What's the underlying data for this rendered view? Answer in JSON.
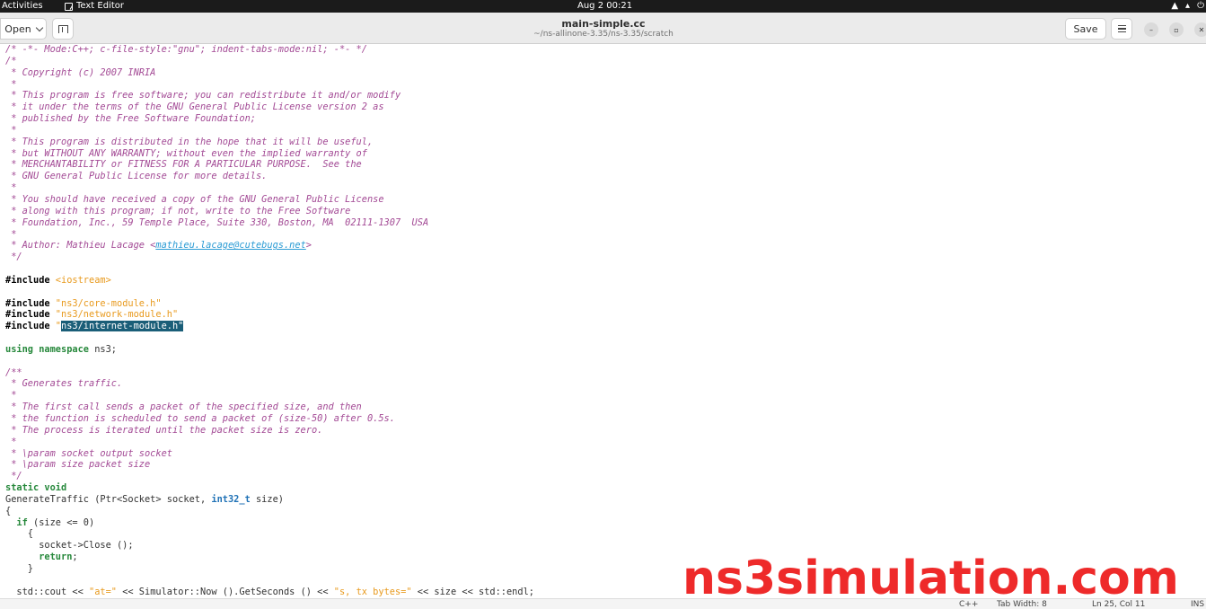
{
  "topbar": {
    "activities": "Activities",
    "app_name": "Text Editor",
    "clock": "Aug 2  00:21"
  },
  "header": {
    "open_label": "Open",
    "title": "main-simple.cc",
    "path": "~/ns-allinone-3.35/ns-3.35/scratch",
    "save_label": "Save"
  },
  "code_lines": [
    [
      {
        "t": "/* -*- Mode:C++; c-file-style:\"gnu\"; indent-tabs-mode:nil; -*- */",
        "c": "c"
      }
    ],
    [
      {
        "t": "/*",
        "c": "c"
      }
    ],
    [
      {
        "t": " * Copyright (c) 2007 INRIA",
        "c": "c"
      }
    ],
    [
      {
        "t": " *",
        "c": "c"
      }
    ],
    [
      {
        "t": " * This program is free software; you can redistribute it and/or modify",
        "c": "c"
      }
    ],
    [
      {
        "t": " * it under the terms of the GNU General Public License version 2 as",
        "c": "c"
      }
    ],
    [
      {
        "t": " * published by the Free Software Foundation;",
        "c": "c"
      }
    ],
    [
      {
        "t": " *",
        "c": "c"
      }
    ],
    [
      {
        "t": " * This program is distributed in the hope that it will be useful,",
        "c": "c"
      }
    ],
    [
      {
        "t": " * but WITHOUT ANY WARRANTY; without even the implied warranty of",
        "c": "c"
      }
    ],
    [
      {
        "t": " * MERCHANTABILITY or FITNESS FOR A PARTICULAR PURPOSE.  See the",
        "c": "c"
      }
    ],
    [
      {
        "t": " * GNU General Public License for more details.",
        "c": "c"
      }
    ],
    [
      {
        "t": " *",
        "c": "c"
      }
    ],
    [
      {
        "t": " * You should have received a copy of the GNU General Public License",
        "c": "c"
      }
    ],
    [
      {
        "t": " * along with this program; if not, write to the Free Software",
        "c": "c"
      }
    ],
    [
      {
        "t": " * Foundation, Inc., 59 Temple Place, Suite 330, Boston, MA  02111-1307  USA",
        "c": "c"
      }
    ],
    [
      {
        "t": " *",
        "c": "c"
      }
    ],
    [
      {
        "t": " * Author: Mathieu Lacage <",
        "c": "c"
      },
      {
        "t": "mathieu.lacage@cutebugs.net",
        "c": "url"
      },
      {
        "t": ">",
        "c": "c"
      }
    ],
    [
      {
        "t": " */",
        "c": "c"
      }
    ],
    [],
    [
      {
        "t": "#include ",
        "c": "pp"
      },
      {
        "t": "<iostream>",
        "c": "s"
      }
    ],
    [],
    [
      {
        "t": "#include ",
        "c": "pp"
      },
      {
        "t": "\"ns3/core-module.h\"",
        "c": "s"
      }
    ],
    [
      {
        "t": "#include ",
        "c": "pp"
      },
      {
        "t": "\"ns3/network-module.h\"",
        "c": "s"
      }
    ],
    [
      {
        "t": "#include ",
        "c": "pp"
      },
      {
        "t": "\"",
        "c": "s"
      },
      {
        "t": "ns3/internet-module.h\"",
        "c": "sel"
      }
    ],
    [],
    [
      {
        "t": "using namespace",
        "c": "kw"
      },
      {
        "t": " ns3;",
        "c": ""
      }
    ],
    [],
    [
      {
        "t": "/**",
        "c": "c"
      }
    ],
    [
      {
        "t": " * Generates traffic.",
        "c": "c"
      }
    ],
    [
      {
        "t": " *",
        "c": "c"
      }
    ],
    [
      {
        "t": " * The first call sends a packet of the specified size, and then",
        "c": "c"
      }
    ],
    [
      {
        "t": " * the function is scheduled to send a packet of (size-50) after 0.5s.",
        "c": "c"
      }
    ],
    [
      {
        "t": " * The process is iterated until the packet size is zero.",
        "c": "c"
      }
    ],
    [
      {
        "t": " *",
        "c": "c"
      }
    ],
    [
      {
        "t": " * \\param socket output socket",
        "c": "c"
      }
    ],
    [
      {
        "t": " * \\param size packet size",
        "c": "c"
      }
    ],
    [
      {
        "t": " */",
        "c": "c"
      }
    ],
    [
      {
        "t": "static void",
        "c": "kw"
      }
    ],
    [
      {
        "t": "GenerateTraffic (Ptr<Socket> socket, ",
        "c": ""
      },
      {
        "t": "int32_t",
        "c": "ty"
      },
      {
        "t": " size)",
        "c": ""
      }
    ],
    [
      {
        "t": "{",
        "c": ""
      }
    ],
    [
      {
        "t": "  ",
        "c": ""
      },
      {
        "t": "if",
        "c": "kw"
      },
      {
        "t": " (size <= 0)",
        "c": ""
      }
    ],
    [
      {
        "t": "    {",
        "c": ""
      }
    ],
    [
      {
        "t": "      socket->Close ();",
        "c": ""
      }
    ],
    [
      {
        "t": "      ",
        "c": ""
      },
      {
        "t": "return",
        "c": "kw"
      },
      {
        "t": ";",
        "c": ""
      }
    ],
    [
      {
        "t": "    }",
        "c": ""
      }
    ],
    [],
    [
      {
        "t": "  std::cout << ",
        "c": ""
      },
      {
        "t": "\"at=\"",
        "c": "s"
      },
      {
        "t": " << Simulator::Now ().GetSeconds () << ",
        "c": ""
      },
      {
        "t": "\"s, tx bytes=\"",
        "c": "s"
      },
      {
        "t": " << size << std::endl;",
        "c": ""
      }
    ]
  ],
  "watermark": "ns3simulation.com",
  "statusbar": {
    "language": "C++",
    "tab_width": "Tab Width: 8",
    "position": "Ln 25, Col 11",
    "mode": "INS"
  }
}
